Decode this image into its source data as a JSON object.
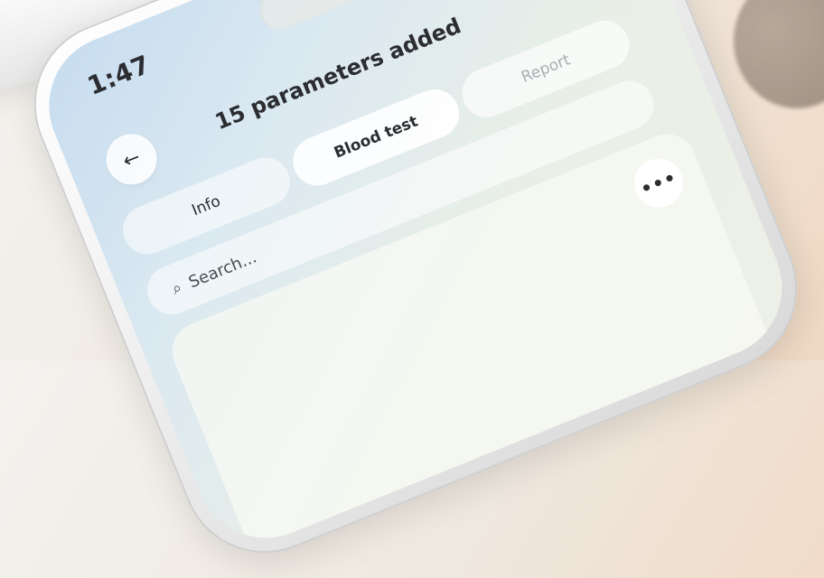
{
  "status_bar": {
    "time": "1:47"
  },
  "header": {
    "title": "15 parameters added"
  },
  "tabs": [
    {
      "label": "Info",
      "state": "default"
    },
    {
      "label": "Blood test",
      "state": "active"
    },
    {
      "label": "Report",
      "state": "muted"
    }
  ],
  "search": {
    "placeholder": "Search..."
  },
  "card": {
    "more_label": "•••"
  },
  "icons": {
    "back": "arrow-left-icon",
    "timer": "hourglass-icon",
    "more": "more-dots-icon",
    "search": "search-icon"
  },
  "colors": {
    "notification_dot": "#e5474f",
    "muted_text": "#a8aeb3",
    "text": "#2b2d31"
  }
}
